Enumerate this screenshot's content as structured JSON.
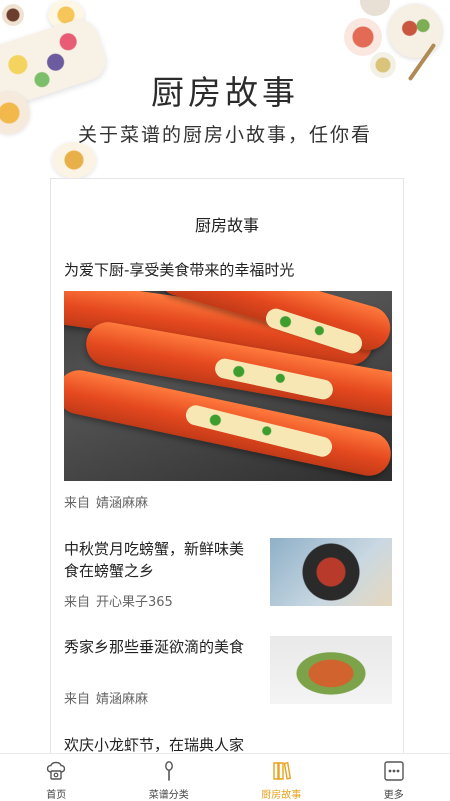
{
  "header": {
    "title": "厨房故事",
    "subtitle": "关于菜谱的厨房小故事，任你看"
  },
  "card": {
    "title": "厨房故事",
    "articles": [
      {
        "title": "为爱下厨-享受美食带来的幸福时光",
        "source_prefix": "来自",
        "author": "婧涵麻麻",
        "image": "grilled-shrimp-image"
      },
      {
        "title": "中秋赏月吃螃蟹，新鲜味美食在螃蟹之乡",
        "source_prefix": "来自",
        "author": "开心果子365",
        "image": "crab-pan-image"
      },
      {
        "title": "秀家乡那些垂涎欲滴的美食",
        "source_prefix": "来自",
        "author": "婧涵麻麻",
        "image": "seafood-platter-image"
      },
      {
        "title": "欢庆小龙虾节，在瑞典人家"
      }
    ]
  },
  "tabbar": {
    "items": [
      {
        "label": "首页",
        "icon": "chef-hat-icon"
      },
      {
        "label": "菜谱分类",
        "icon": "spoon-icon"
      },
      {
        "label": "厨房故事",
        "icon": "book-icon",
        "active": true
      },
      {
        "label": "更多",
        "icon": "more-icon"
      }
    ],
    "active_color": "#e8a21d"
  }
}
